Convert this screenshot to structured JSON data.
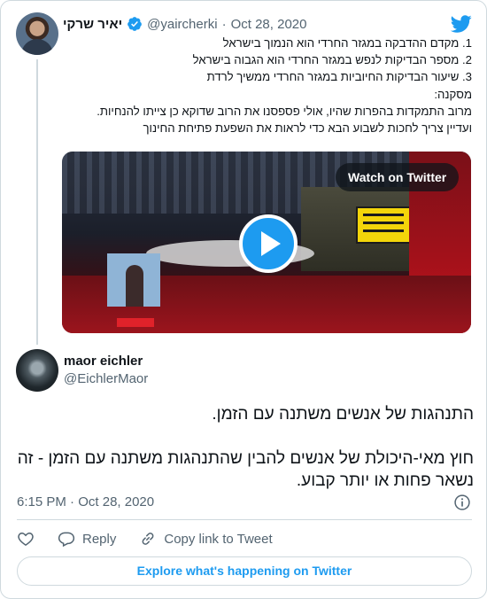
{
  "colors": {
    "accent": "#1d9bf0",
    "text": "#0f1419",
    "secondary": "#536471",
    "border": "#cfd9de"
  },
  "quoted_tweet": {
    "author_name": "יאיר שרקי",
    "verified_icon": "verified-badge-icon",
    "handle": "@yaircherki",
    "separator": "·",
    "date": "Oct 28, 2020",
    "lines": [
      "1. מקדם ההדבקה במגזר החרדי הוא הנמוך בישראל",
      "2. מספר הבדיקות לנפש במגזר החרדי הוא הגבוה בישראל",
      "3. שיעור הבדיקות החיוביות במגזר החרדי ממשיך לרדת",
      "מסקנה:",
      "מרוב התמקדות בהפרות שהיו, אולי פספסנו את הרוב שדוקא כן צייתו להנחיות.",
      "ועדיין צריך לחכות לשבוע הבא כדי לראות את השפעת פתיחת החינוך"
    ],
    "video": {
      "watch_label": "Watch on Twitter",
      "play_icon": "play-icon"
    }
  },
  "platform_icon": "twitter-bird-icon",
  "tweet": {
    "author_name": "maor eichler",
    "handle": "@EichlerMaor",
    "text_lines": [
      "התנהגות של אנשים משתנה עם הזמן.",
      "",
      "חוץ מאי-היכולת של אנשים להבין שהתנהגות משתנה עם הזמן - זה",
      "נשאר פחות או יותר קבוע."
    ],
    "time": "6:15 PM",
    "separator": "·",
    "date": "Oct 28, 2020",
    "info_icon": "info-icon"
  },
  "actions": {
    "like_icon": "heart-icon",
    "reply_label": "Reply",
    "reply_icon": "reply-bubble-icon",
    "copy_label": "Copy link to Tweet",
    "copy_icon": "link-icon"
  },
  "explore_label": "Explore what's happening on Twitter"
}
